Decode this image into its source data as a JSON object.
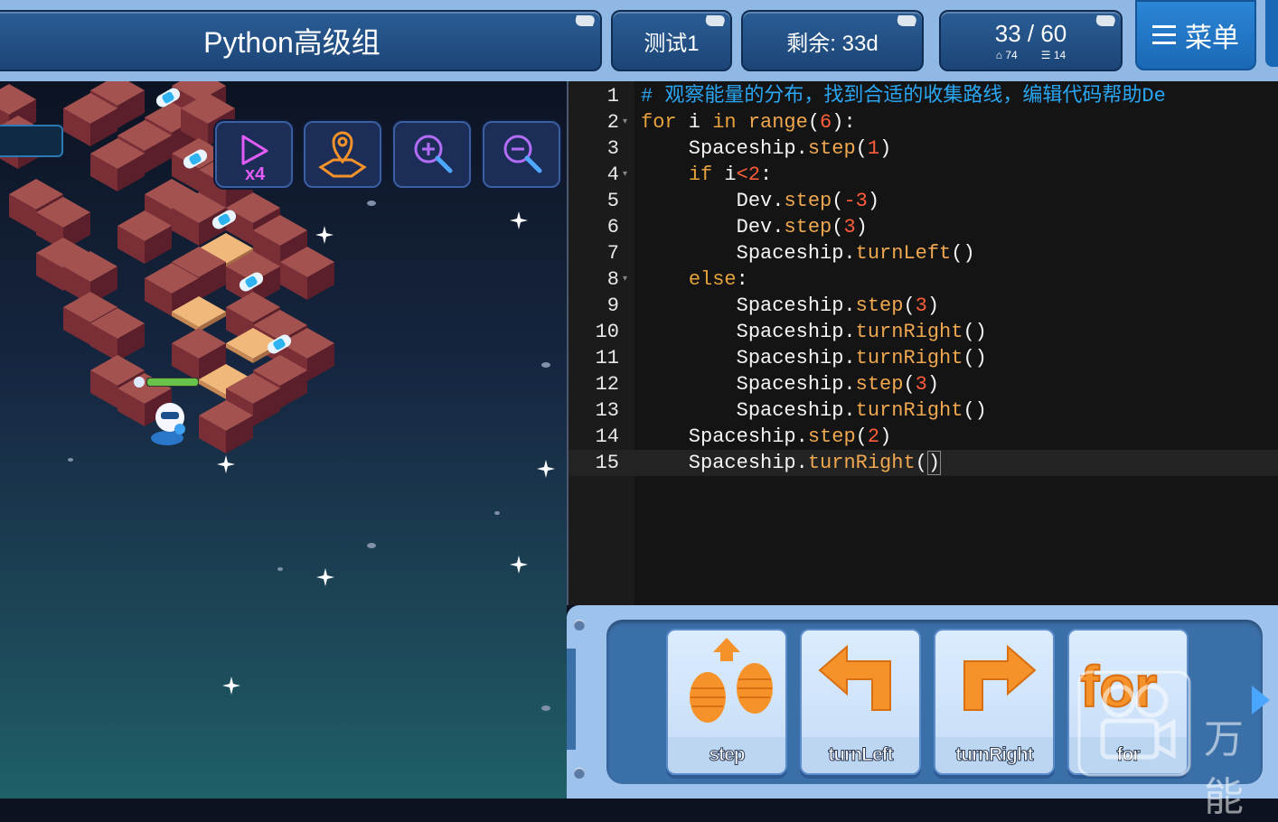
{
  "header": {
    "title": "Python高级组",
    "test_label": "测试1",
    "remaining_label": "剩余: 33d",
    "score": "33 / 60",
    "stat_home": "74",
    "stat_lines": "14",
    "menu_label": "菜单"
  },
  "toolbar": {
    "speed_label": "x4"
  },
  "code": {
    "lines": [
      {
        "n": "1",
        "parts": [
          [
            "c-com",
            "# 观察能量的分布，找到合适的收集路线，编辑代码帮助De"
          ]
        ]
      },
      {
        "n": "2",
        "fold": true,
        "parts": [
          [
            "c-kw",
            "for"
          ],
          [
            "c-txt",
            " i "
          ],
          [
            "c-kw",
            "in"
          ],
          [
            "c-txt",
            " "
          ],
          [
            "c-fn",
            "range"
          ],
          [
            "c-txt",
            "("
          ],
          [
            "c-num",
            "6"
          ],
          [
            "c-txt",
            "):"
          ]
        ]
      },
      {
        "n": "3",
        "parts": [
          [
            "c-txt",
            "    Spaceship."
          ],
          [
            "c-fn",
            "step"
          ],
          [
            "c-txt",
            "("
          ],
          [
            "c-num",
            "1"
          ],
          [
            "c-txt",
            ")"
          ]
        ]
      },
      {
        "n": "4",
        "fold": true,
        "parts": [
          [
            "c-txt",
            "    "
          ],
          [
            "c-kw",
            "if"
          ],
          [
            "c-txt",
            " i"
          ],
          [
            "c-num",
            "<"
          ],
          [
            "c-num",
            "2"
          ],
          [
            "c-txt",
            ":"
          ]
        ]
      },
      {
        "n": "5",
        "parts": [
          [
            "c-txt",
            "        Dev."
          ],
          [
            "c-fn",
            "step"
          ],
          [
            "c-txt",
            "("
          ],
          [
            "c-num",
            "-3"
          ],
          [
            "c-txt",
            ")"
          ]
        ]
      },
      {
        "n": "6",
        "parts": [
          [
            "c-txt",
            "        Dev."
          ],
          [
            "c-fn",
            "step"
          ],
          [
            "c-txt",
            "("
          ],
          [
            "c-num",
            "3"
          ],
          [
            "c-txt",
            ")"
          ]
        ]
      },
      {
        "n": "7",
        "parts": [
          [
            "c-txt",
            "        Spaceship."
          ],
          [
            "c-fn",
            "turnLeft"
          ],
          [
            "c-txt",
            "()"
          ]
        ]
      },
      {
        "n": "8",
        "fold": true,
        "parts": [
          [
            "c-txt",
            "    "
          ],
          [
            "c-kw",
            "else"
          ],
          [
            "c-txt",
            ":"
          ]
        ]
      },
      {
        "n": "9",
        "parts": [
          [
            "c-txt",
            "        Spaceship."
          ],
          [
            "c-fn",
            "step"
          ],
          [
            "c-txt",
            "("
          ],
          [
            "c-num",
            "3"
          ],
          [
            "c-txt",
            ")"
          ]
        ]
      },
      {
        "n": "10",
        "parts": [
          [
            "c-txt",
            "        Spaceship."
          ],
          [
            "c-fn",
            "turnRight"
          ],
          [
            "c-txt",
            "()"
          ]
        ]
      },
      {
        "n": "11",
        "parts": [
          [
            "c-txt",
            "        Spaceship."
          ],
          [
            "c-fn",
            "turnRight"
          ],
          [
            "c-txt",
            "()"
          ]
        ]
      },
      {
        "n": "12",
        "parts": [
          [
            "c-txt",
            "        Spaceship."
          ],
          [
            "c-fn",
            "step"
          ],
          [
            "c-txt",
            "("
          ],
          [
            "c-num",
            "3"
          ],
          [
            "c-txt",
            ")"
          ]
        ]
      },
      {
        "n": "13",
        "parts": [
          [
            "c-txt",
            "        Spaceship."
          ],
          [
            "c-fn",
            "turnRight"
          ],
          [
            "c-txt",
            "()"
          ]
        ]
      },
      {
        "n": "14",
        "parts": [
          [
            "c-txt",
            "    Spaceship."
          ],
          [
            "c-fn",
            "step"
          ],
          [
            "c-txt",
            "("
          ],
          [
            "c-num",
            "2"
          ],
          [
            "c-txt",
            ")"
          ]
        ]
      },
      {
        "n": "15",
        "active": true,
        "parts": [
          [
            "c-txt",
            "    Spaceship."
          ],
          [
            "c-fn",
            "turnRight"
          ],
          [
            "c-txt",
            "("
          ],
          [
            "cursor-box c-txt",
            ")"
          ]
        ]
      }
    ]
  },
  "palette": {
    "blocks": [
      {
        "label": "step",
        "icon": "step-icon"
      },
      {
        "label": "turnLeft",
        "icon": "turn-left-icon"
      },
      {
        "label": "turnRight",
        "icon": "turn-right-icon"
      },
      {
        "label": "for",
        "icon": "for-loop-icon"
      }
    ]
  },
  "watermark": {
    "text": "万能"
  },
  "colors": {
    "comment": "#2aa6f2",
    "keyword": "#e6a23c",
    "number": "#ff5e3a",
    "header_blue": "#1c4577",
    "accent_orange": "#f5922a"
  }
}
